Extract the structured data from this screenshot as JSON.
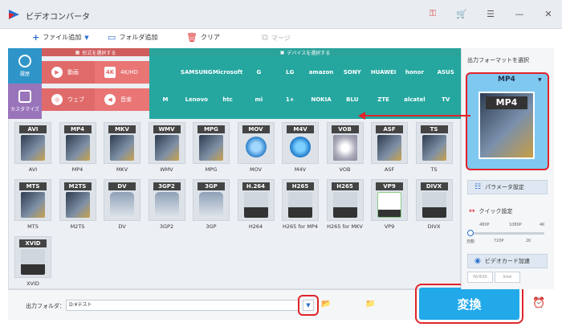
{
  "app": {
    "title": "ビデオコンバータ",
    "brand_color": "#22a9ea",
    "highlight_color": "#e0242b"
  },
  "toolbar": {
    "add_file": "ファイル追加",
    "add_folder": "フォルダ追加",
    "clear": "クリア",
    "merge": "マージ"
  },
  "sidebar": {
    "history": "履歴",
    "custom": "カスタマイズ"
  },
  "categories": {
    "format_header": "形式を選択する",
    "device_header": "デバイスを選択する",
    "items": [
      "動画",
      "4K/HD",
      "ウェブ",
      "音楽"
    ],
    "icons": [
      "4K"
    ]
  },
  "devices": {
    "row1": [
      "",
      "SAMSUNG",
      "Microsoft",
      "G",
      "LG",
      "amazon",
      "SONY",
      "HUAWEI",
      "honor",
      "ASUS"
    ],
    "row2": [
      "M",
      "Lenovo",
      "htc",
      "mi",
      "1+",
      "NOKIA",
      "BLU",
      "ZTE",
      "alcatel",
      "TV"
    ]
  },
  "formats": [
    {
      "badge": "AVI",
      "label": "AVI"
    },
    {
      "badge": "MP4",
      "label": "MP4"
    },
    {
      "badge": "MKV",
      "label": "MKV"
    },
    {
      "badge": "WMV",
      "label": "WMV"
    },
    {
      "badge": "MPG",
      "label": "MPG"
    },
    {
      "badge": "MOV",
      "label": "MOV"
    },
    {
      "badge": "M4V",
      "label": "M4V"
    },
    {
      "badge": "VOB",
      "label": "VOB"
    },
    {
      "badge": "ASF",
      "label": "ASF"
    },
    {
      "badge": "TS",
      "label": "TS"
    },
    {
      "badge": "MTS",
      "label": "MTS"
    },
    {
      "badge": "M2TS",
      "label": "M2TS"
    },
    {
      "badge": "DV",
      "label": "DV"
    },
    {
      "badge": "3GP2",
      "label": "3GP2"
    },
    {
      "badge": "3GP",
      "label": "3GP"
    },
    {
      "badge": "H.264",
      "label": "H264"
    },
    {
      "badge": "H265",
      "label": "H265 for MP4"
    },
    {
      "badge": "H265",
      "label": "H265 for MKV"
    },
    {
      "badge": "VP9",
      "label": "VP9"
    },
    {
      "badge": "DIVX",
      "label": "DIVX"
    },
    {
      "badge": "XVID",
      "label": "XVID"
    }
  ],
  "output": {
    "label": "出力フォルダ：",
    "path": "D:¥テスト"
  },
  "convert": {
    "label": "変換"
  },
  "right": {
    "title": "出力フォーマットを選択",
    "selected": "MP4",
    "icon_badge": "MP4",
    "param": "パラメータ設定",
    "quick": "クイック設定",
    "scale_top": [
      "480P",
      "1080P",
      "4K"
    ],
    "scale_bottom": [
      "自動",
      "720P",
      "2K"
    ],
    "gpu": "ビデオカード加速",
    "gpu_chips": [
      "NVIDIA",
      "Intel"
    ]
  }
}
